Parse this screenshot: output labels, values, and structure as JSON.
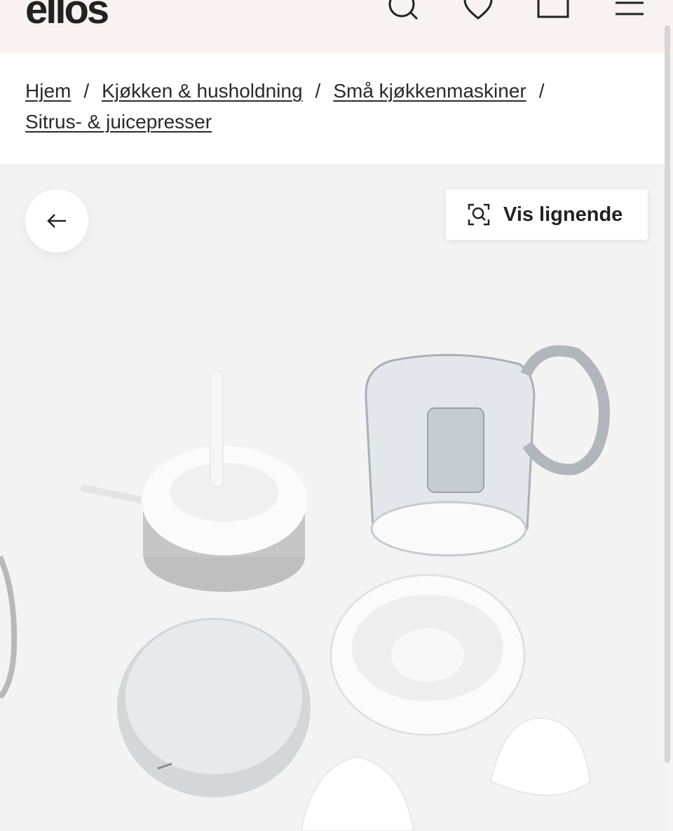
{
  "header": {
    "logo": "ellos",
    "icons": [
      "search-icon",
      "heart-icon",
      "bag-icon",
      "menu-icon"
    ]
  },
  "breadcrumb": {
    "items": [
      "Hjem",
      "Kjøkken & husholdning",
      "Små kjøkkenmaskiner",
      "Sitrus- & juicepresser"
    ],
    "separator": "/"
  },
  "gallery": {
    "back_icon": "arrow-left-icon",
    "similar_button": {
      "icon": "visual-search-icon",
      "label": "Vis lignende"
    }
  },
  "colors": {
    "header_bg": "#f8f3f1",
    "page_bg": "#f3f3f3",
    "text": "#222222"
  }
}
